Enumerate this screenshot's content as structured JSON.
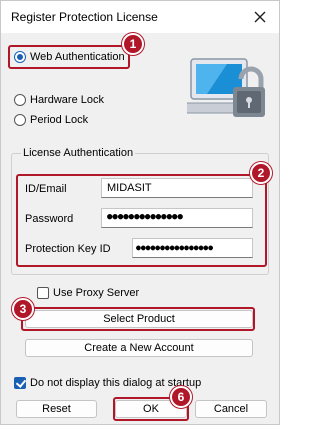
{
  "window": {
    "title": "Register Protection License"
  },
  "auth_options": {
    "web": "Web Authentication",
    "hardware": "Hardware Lock",
    "period": "Period Lock",
    "selected": "Web Authentication"
  },
  "license_group": {
    "title": "License Authentication",
    "id_label": "ID/Email",
    "id_value": "MIDASIT",
    "password_label": "Password",
    "password_value": "●●●●●●●●●●●●●●",
    "key_label": "Protection Key ID",
    "key_value": "●●●●●●●●●●●●●●●●"
  },
  "proxy": {
    "label": "Use Proxy Server",
    "checked": false
  },
  "buttons": {
    "select_product": "Select Product",
    "create_account": "Create a New Account",
    "reset": "Reset",
    "ok": "OK",
    "cancel": "Cancel"
  },
  "dont_display": {
    "label": "Do not display this dialog at startup",
    "checked": true
  },
  "annotations": {
    "step1": "1",
    "step2": "2",
    "step3": "3",
    "step6": "6"
  },
  "icons": {
    "close": "close-icon",
    "lock": "lock-computer-icon"
  },
  "colors": {
    "highlight": "#b0182a",
    "accent": "#1a5fb4"
  }
}
